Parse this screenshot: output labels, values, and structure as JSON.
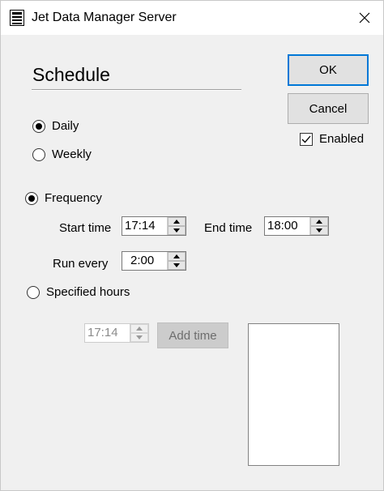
{
  "window": {
    "title": "Jet Data Manager Server",
    "icon": "server-app-icon"
  },
  "heading": "Schedule",
  "buttons": {
    "ok": "OK",
    "cancel": "Cancel",
    "add_time": "Add time"
  },
  "enabled": {
    "label": "Enabled",
    "checked": true
  },
  "schedule_type": {
    "daily": {
      "label": "Daily",
      "selected": true
    },
    "weekly": {
      "label": "Weekly",
      "selected": false
    }
  },
  "mode": {
    "frequency": {
      "label": "Frequency",
      "selected": true
    },
    "specified_hours": {
      "label": "Specified hours",
      "selected": false
    }
  },
  "frequency": {
    "start_label": "Start time",
    "start_value": "17:14",
    "end_label": "End time",
    "end_value": "18:00",
    "run_every_label": "Run every",
    "run_every_value": "2:00"
  },
  "specified": {
    "time_value": "17:14"
  },
  "colors": {
    "accent": "#0078d7",
    "background": "#f0f0f0"
  }
}
